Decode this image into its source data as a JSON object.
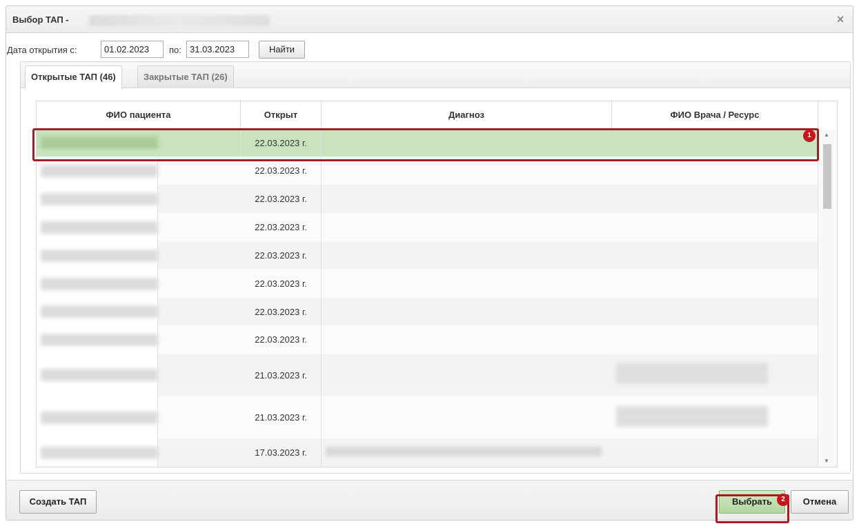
{
  "dialog": {
    "title": "Выбор ТАП -",
    "close_symbol": "×"
  },
  "filter": {
    "date_from_label": "Дата открытия с:",
    "date_from_value": "01.02.2023",
    "date_to_label": "по:",
    "date_to_value": "31.03.2023",
    "search_button": "Найти"
  },
  "tabs": [
    {
      "label": "Открытые ТАП (46)",
      "active": true
    },
    {
      "label": "Закрытые ТАП (26)",
      "active": false
    }
  ],
  "table": {
    "columns": [
      "ФИО пациента",
      "Открыт",
      "Диагноз",
      "ФИО Врача / Ресурс"
    ],
    "rows": [
      {
        "opened": "22.03.2023 г.",
        "selected": true
      },
      {
        "opened": "22.03.2023 г."
      },
      {
        "opened": "22.03.2023 г."
      },
      {
        "opened": "22.03.2023 г."
      },
      {
        "opened": "22.03.2023 г."
      },
      {
        "opened": "22.03.2023 г."
      },
      {
        "opened": "22.03.2023 г."
      },
      {
        "opened": "22.03.2023 г."
      },
      {
        "opened": "21.03.2023 г."
      },
      {
        "opened": "21.03.2023 г."
      },
      {
        "opened": "17.03.2023 г."
      }
    ]
  },
  "footer": {
    "create_button": "Создать ТАП",
    "select_button": "Выбрать",
    "cancel_button": "Отмена"
  },
  "annotations": {
    "badge_1": "1",
    "badge_2": "2"
  },
  "colors": {
    "selected_row": "#c8e3bd",
    "highlight_border": "#a31d23",
    "badge": "#c4161c",
    "select_button": "#b4d6a0"
  }
}
